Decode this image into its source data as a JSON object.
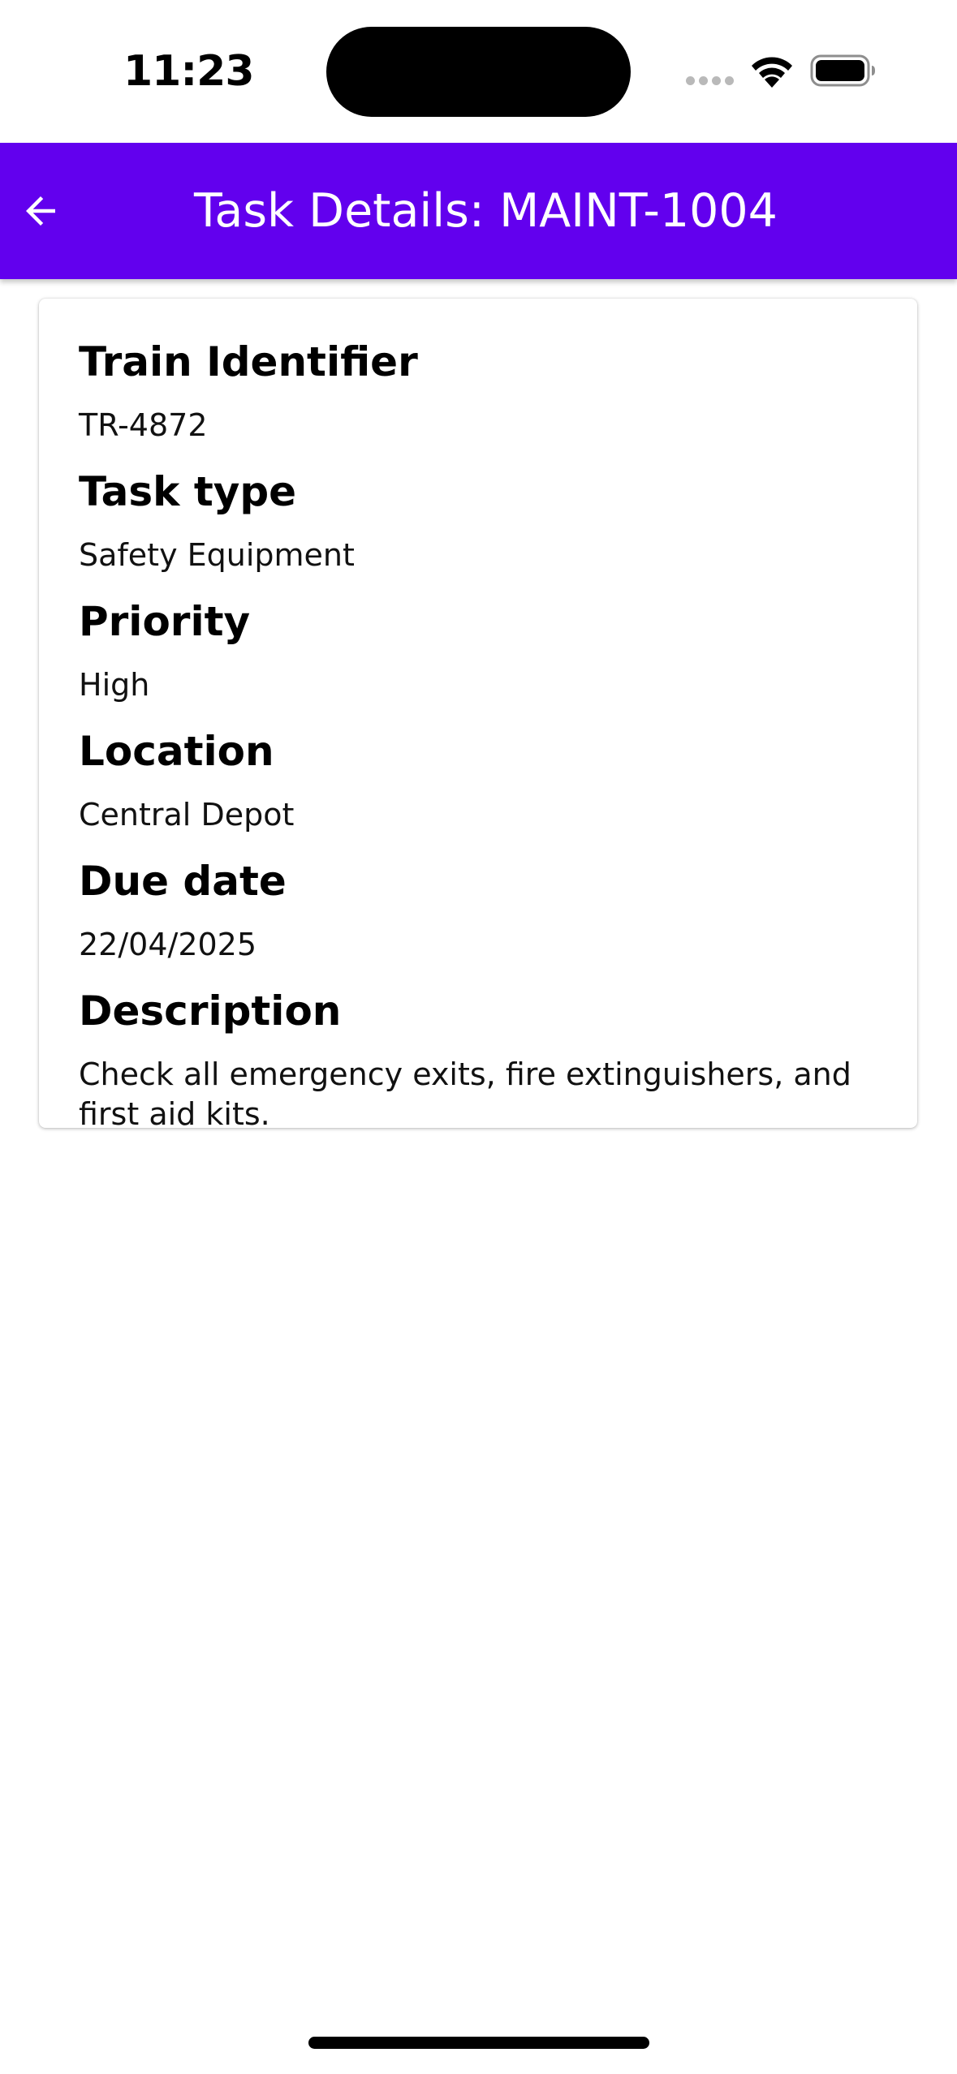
{
  "status_bar": {
    "time": "11:23",
    "icons": [
      "cellular-signal-icon",
      "wifi-icon",
      "battery-icon"
    ]
  },
  "app_bar": {
    "title": "Task Details: MAINT-1004",
    "back_icon": "arrow-left-icon",
    "background_color": "#6200ee",
    "title_color": "#ffffff"
  },
  "details": {
    "train_identifier": {
      "label": "Train Identifier",
      "value": "TR-4872"
    },
    "task_type": {
      "label": "Task type",
      "value": "Safety Equipment"
    },
    "priority": {
      "label": "Priority",
      "value": "High"
    },
    "location": {
      "label": "Location",
      "value": "Central Depot"
    },
    "due_date": {
      "label": "Due date",
      "value": "22/04/2025"
    },
    "description": {
      "label": "Description",
      "value": "Check all emergency exits, fire extinguishers, and first aid kits."
    }
  }
}
